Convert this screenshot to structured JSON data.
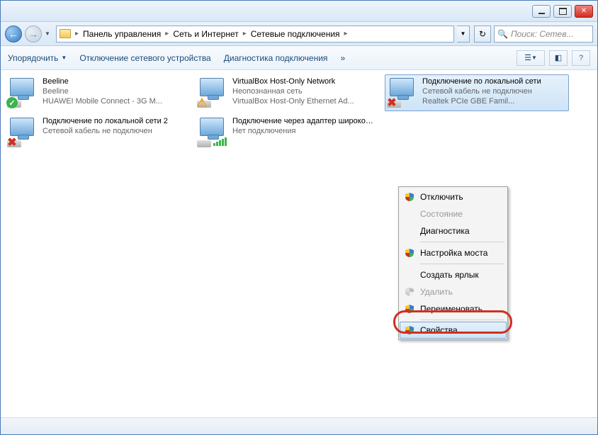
{
  "titlebar": {},
  "breadcrumb": {
    "root": "Панель управления",
    "cat": "Сеть и Интернет",
    "sub": "Сетевые подключения"
  },
  "search": {
    "placeholder": "Поиск: Сетев..."
  },
  "toolbar": {
    "organize": "Упорядочить",
    "disable": "Отключение сетевого устройства",
    "diagnose": "Диагностика подключения",
    "chevrons": "»"
  },
  "connections": [
    {
      "title": "Beeline",
      "status": "Beeline",
      "device": "HUAWEI Mobile Connect - 3G M...",
      "badge": "check"
    },
    {
      "title": "VirtualBox Host-Only Network",
      "status": "Неопознанная сеть",
      "device": "VirtualBox Host-Only Ethernet Ad...",
      "badge": "warn"
    },
    {
      "title": "Подключение по локальной сети",
      "status": "Сетевой кабель не подключен",
      "device": "Realtek PCIe GBE Famil...",
      "badge": "x",
      "selected": true
    },
    {
      "title": "Подключение по локальной сети 2",
      "status": "Сетевой кабель не подключен",
      "device": "",
      "badge": "x"
    },
    {
      "title": "Подключение через адаптер широкополосной мобильной с...",
      "status": "Нет подключения",
      "device": "",
      "badge": "bars"
    }
  ],
  "context_menu": {
    "items": [
      {
        "label": "Отключить",
        "shield": true
      },
      {
        "label": "Состояние",
        "disabled": true
      },
      {
        "label": "Диагностика"
      },
      {
        "sep": true
      },
      {
        "label": "Настройка моста",
        "shield": true
      },
      {
        "sep": true
      },
      {
        "label": "Создать ярлык"
      },
      {
        "label": "Удалить",
        "disabled": true,
        "shield": true,
        "shield_gray": true
      },
      {
        "label": "Переименовать",
        "shield": true
      },
      {
        "sep": true
      },
      {
        "label": "Свойства",
        "shield": true,
        "highlighted": true
      }
    ]
  }
}
